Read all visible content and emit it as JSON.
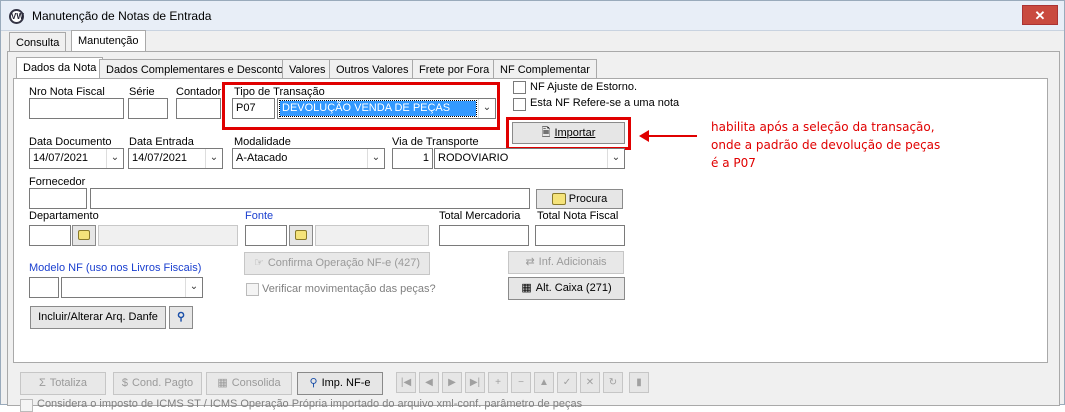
{
  "window": {
    "title": "Manutenção de Notas de Entrada",
    "close_label": "✕"
  },
  "top_tabs": [
    "Consulta",
    "Manutenção"
  ],
  "sub_tabs": [
    "Dados da Nota",
    "Dados Complementares e Desconto",
    "Valores",
    "Outros Valores",
    "Frete por Fora",
    "NF Complementar"
  ],
  "form": {
    "nro_nota_label": "Nro Nota Fiscal",
    "serie_label": "Série",
    "contador_label": "Contador",
    "tipo_transacao_label": "Tipo de Transação",
    "tipo_transacao_code": "P07",
    "tipo_transacao_value": "DEVOLUÇÃO VENDA DE PEÇAS",
    "nf_ajuste_label": "NF Ajuste  de Estorno.",
    "nf_refere_label": "Esta NF Refere-se a uma nota",
    "importar_label": "Importar",
    "data_documento_label": "Data Documento",
    "data_documento_value": "14/07/2021",
    "data_entrada_label": "Data Entrada",
    "data_entrada_value": "14/07/2021",
    "modalidade_label": "Modalidade",
    "modalidade_value": "A-Atacado",
    "via_transporte_label": "Via de Transporte",
    "via_transporte_code": "1",
    "via_transporte_value": "RODOVIARIO",
    "fornecedor_label": "Fornecedor",
    "procura_label": "Procura",
    "departamento_label": "Departamento",
    "fonte_label": "Fonte",
    "total_mercadoria_label": "Total Mercadoria",
    "total_nota_fiscal_label": "Total Nota Fiscal",
    "confirma_nfe_label": "Confirma Operação NF-e (427)",
    "inf_adicionais_label": "Inf. Adicionais",
    "modelo_nf_label": "Modelo NF (uso nos Livros Fiscais)",
    "verificar_label": "Verificar movimentação das peças?",
    "alt_caixa_label": "Alt. Caixa (271)",
    "incluir_danfe_label": "Incluir/Alterar Arq. Danfe"
  },
  "annotation": {
    "lines": [
      "habilita após a seleção da transação,",
      "onde a padrão de devolução de peças",
      "é a P07"
    ]
  },
  "toolbar": {
    "totaliza_label": "Totaliza",
    "cond_pagto_label": "Cond. Pagto",
    "consolida_label": "Consolida",
    "imp_nfe_label": "Imp. NF-e"
  },
  "footer": {
    "considera_label": "Considera o imposto de ICMS ST / ICMS Operação Própria importado do arquivo xml-conf. parâmetro de peças"
  },
  "colors": {
    "annotation_red": "#e00000",
    "label_blue": "#1a3fcf",
    "selection_blue": "#3399ff"
  }
}
